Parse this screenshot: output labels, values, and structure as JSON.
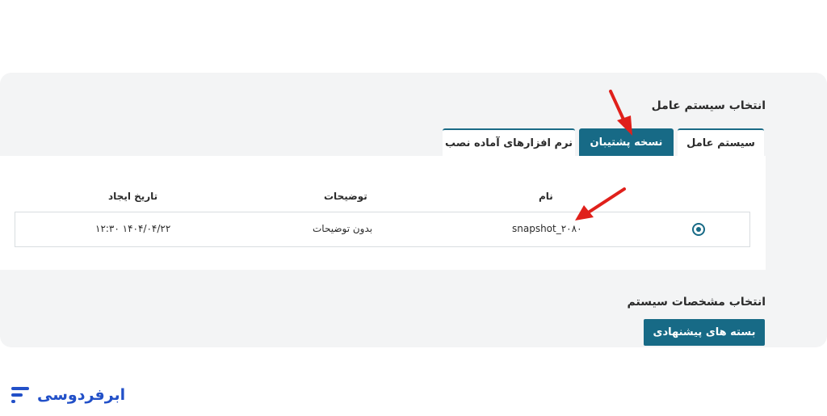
{
  "os_section": {
    "title": "انتخاب سیستم عامل",
    "tabs": [
      {
        "label": "سیستم عامل",
        "active": false
      },
      {
        "label": "نسخه پشتیبان",
        "active": true
      },
      {
        "label": "نرم افزارهای آماده نصب",
        "active": false
      }
    ],
    "table": {
      "headers": {
        "name": "نام",
        "description": "توضیحات",
        "created": "تاریخ ایجاد"
      },
      "rows": [
        {
          "selected": true,
          "name": "snapshot_۲۰۸۰",
          "description": "بدون توضیحات",
          "created": "۱۴۰۴/۰۴/۲۲ ۱۲:۳۰"
        }
      ]
    }
  },
  "spec_section": {
    "title": "انتخاب مشخصات سیستم",
    "button_label": "بسته های پیشنهادی"
  },
  "brand": {
    "name": "ابرفردوسی",
    "color": "#2250c8"
  },
  "colors": {
    "accent": "#176a86",
    "annotation_arrow": "#e0201b",
    "panel_bg": "#f3f4f5"
  }
}
